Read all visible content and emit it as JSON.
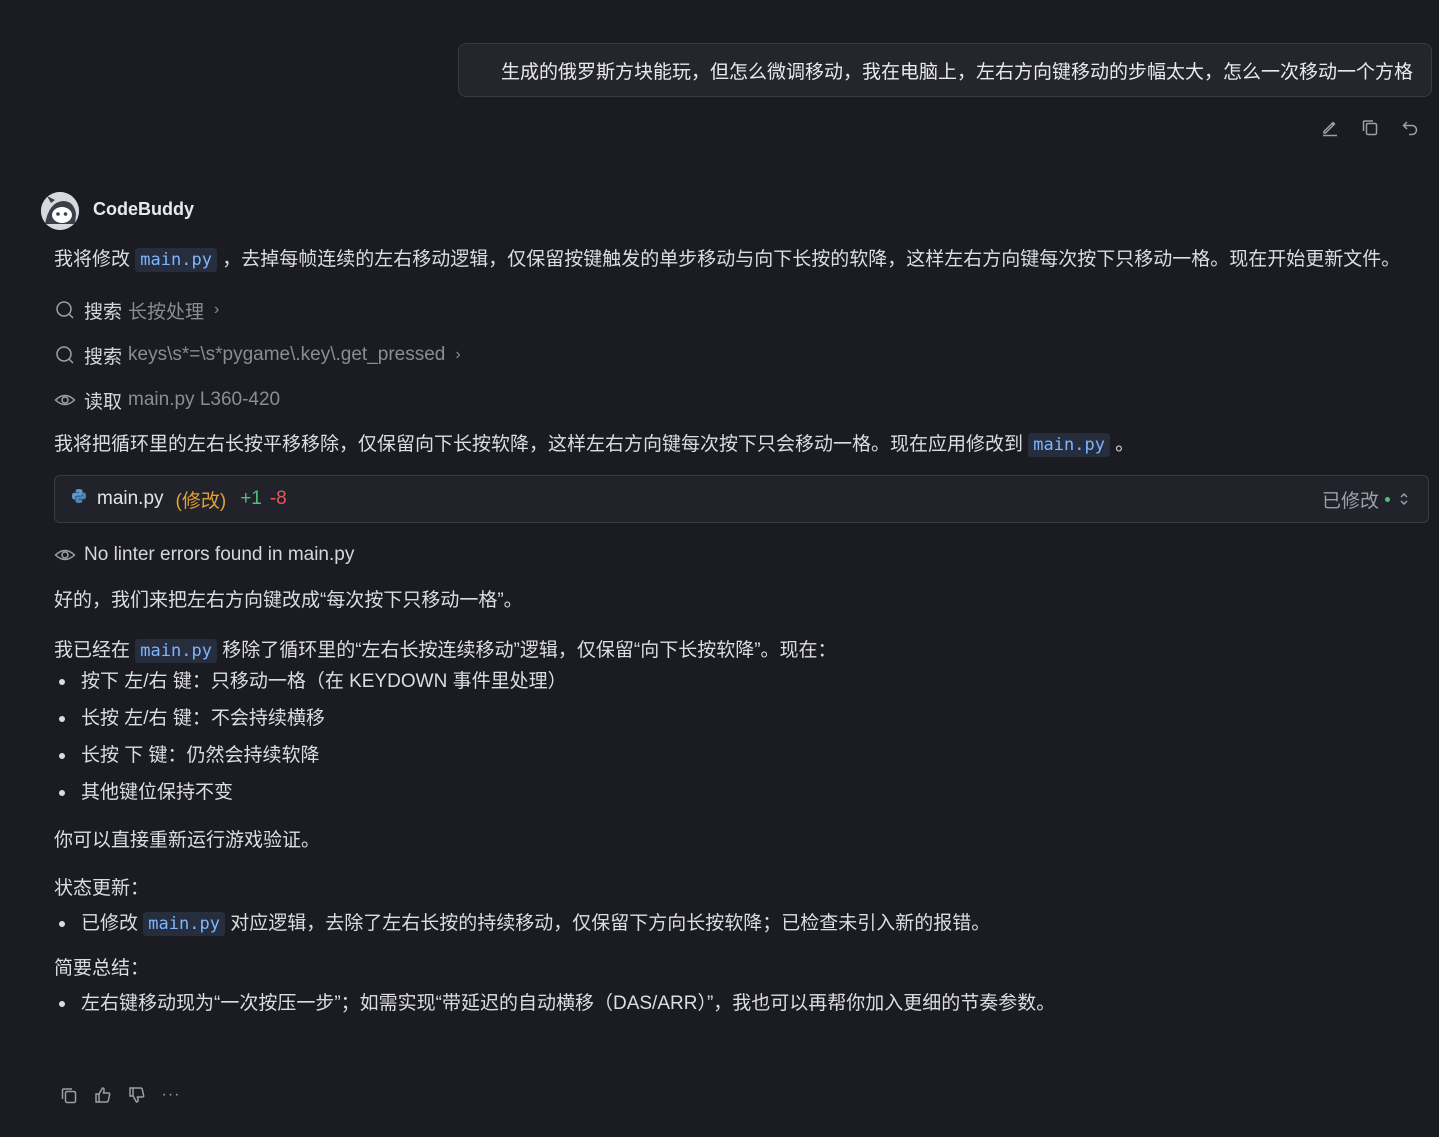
{
  "user_message": "生成的俄罗斯方块能玩，但怎么微调移动，我在电脑上，左右方向键移动的步幅太大，怎么一次移动一个方格",
  "bot_name": "CodeBuddy",
  "intro": {
    "pre": "我将修改",
    "code": "main.py",
    "post": "，去掉每帧连续的左右移动逻辑，仅保留按键触发的单步移动与向下长按的软降，这样左右方向键每次按下只移动一格。现在开始更新文件。"
  },
  "tools": [
    {
      "action": "搜索",
      "arg": "长按处理",
      "icon": "search-icon",
      "chev": "›"
    },
    {
      "action": "搜索",
      "arg": "keys\\s*=\\s*pygame\\.key\\.get_pressed",
      "icon": "search-icon",
      "chev": "›"
    },
    {
      "action": "读取",
      "arg": "main.py L360-420",
      "icon": "eye-icon"
    }
  ],
  "apply": {
    "pre": "我将把循环里的左右长按平移移除，仅保留向下长按软降，这样左右方向键每次按下只会移动一格。现在应用修改到",
    "code": "main.py",
    "post": "。"
  },
  "file_card": {
    "name": "main.py",
    "mod": "(修改)",
    "add": "+1",
    "del": "-8",
    "status": "已修改",
    "icon": "python-icon"
  },
  "lint": "No linter errors found in main.py",
  "ok_line": "好的，我们来把左右方向键改成“每次按下只移动一格”。",
  "done": {
    "pre": "我已经在",
    "code": "main.py",
    "post": "移除了循环里的“左右长按连续移动”逻辑，仅保留“向下长按软降”。现在："
  },
  "bullets1": [
    "按下 左/右 键：只移动一格（在 KEYDOWN 事件里处理）",
    "长按 左/右 键：不会持续横移",
    "长按 下 键：仍然会持续软降",
    "其他键位保持不变"
  ],
  "rerun": "你可以直接重新运行游戏验证。",
  "status_title": "状态更新：",
  "status_bullet": {
    "pre": "已修改",
    "code": "main.py",
    "post": "对应逻辑，去除了左右长按的持续移动，仅保留下方向长按软降；已检查未引入新的报错。"
  },
  "summary_title": "简要总结：",
  "summary_bullet": "左右键移动现为“一次按压一步”；如需实现“带延迟的自动横移（DAS/ARR）”，我也可以再帮你加入更细的节奏参数。",
  "bottom_more": "···"
}
